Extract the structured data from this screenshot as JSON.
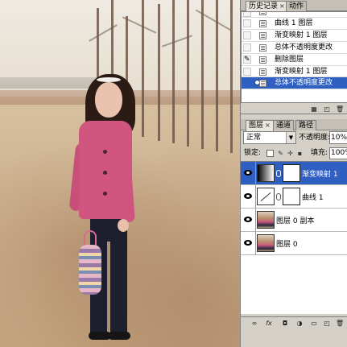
{
  "history_panel": {
    "tabs": [
      {
        "label": "历史记录",
        "close": "×"
      },
      {
        "label": "动作",
        "close": ""
      }
    ],
    "items": [
      {
        "label": ""
      },
      {
        "label": "曲线 1 图层"
      },
      {
        "label": "渐变映射 1 图层"
      },
      {
        "label": "总体不透明度更改"
      },
      {
        "label": "删除图层"
      },
      {
        "label": "渐变映射 1 图层"
      },
      {
        "label": "总体不透明度更改"
      }
    ],
    "selected_index": 6
  },
  "layers_panel": {
    "tabs": [
      {
        "label": "图层",
        "close": "×"
      },
      {
        "label": "通道",
        "close": ""
      },
      {
        "label": "路径",
        "close": ""
      }
    ],
    "blend_mode": "正常",
    "opacity_label": "不透明度:",
    "opacity_value": "10%",
    "lock_label": "锁定:",
    "fill_label": "填充:",
    "fill_value": "100%",
    "layers": [
      {
        "name": "渐变映射 1",
        "type": "gradient-map-adjustment",
        "visible": true,
        "selected": true
      },
      {
        "name": "曲线 1",
        "type": "curves-adjustment",
        "visible": true,
        "selected": false
      },
      {
        "name": "图层 0 副本",
        "type": "pixel",
        "visible": true,
        "selected": false
      },
      {
        "name": "图层 0",
        "type": "pixel",
        "visible": true,
        "selected": false
      }
    ]
  },
  "colors": {
    "selection": "#2f5fc0",
    "panel_bg": "#d4d0c8",
    "coat": "#d0567f"
  },
  "icons": {
    "history_footer": [
      "new-document-icon",
      "new-snapshot-icon",
      "trash-icon"
    ],
    "layers_footer": [
      "link-icon",
      "fx-icon",
      "mask-icon",
      "adjustment-icon",
      "group-folder-icon",
      "new-layer-icon",
      "trash-icon"
    ]
  }
}
